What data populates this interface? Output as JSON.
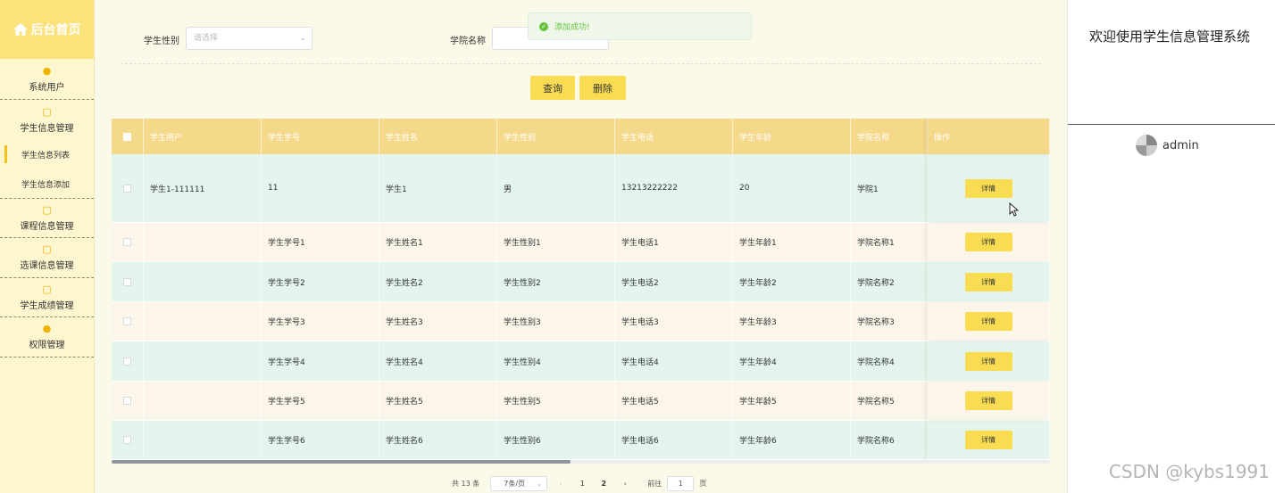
{
  "sidebar": {
    "home_label": "后台首页",
    "items": [
      {
        "label": "系统用户",
        "icon": "user-icon"
      },
      {
        "label": "学生信息管理",
        "icon": "note-icon",
        "children": [
          "学生信息列表",
          "学生信息添加"
        ]
      },
      {
        "label": "课程信息管理",
        "icon": "note-icon"
      },
      {
        "label": "选课信息管理",
        "icon": "note-icon"
      },
      {
        "label": "学生成绩管理",
        "icon": "note-icon"
      },
      {
        "label": "权限管理",
        "icon": "user-icon"
      }
    ],
    "active_child": "学生信息列表"
  },
  "header": {
    "welcome": "欢迎使用学生信息管理系统",
    "username": "admin"
  },
  "filters": {
    "gender_label": "学生性别",
    "gender_placeholder": "请选择",
    "college_label": "学院名称",
    "college_value": ""
  },
  "toast": {
    "message": "添加成功!"
  },
  "toolbar": {
    "query_label": "查询",
    "delete_label": "删除"
  },
  "table": {
    "columns": [
      "学生用户",
      "学生学号",
      "学生姓名",
      "学生性别",
      "学生电话",
      "学生年龄",
      "学院名称",
      "操作"
    ],
    "rows": [
      [
        "学生1-111111",
        "11",
        "学生1",
        "男",
        "13213222222",
        "20",
        "学院1"
      ],
      [
        "",
        "学生学号1",
        "学生姓名1",
        "学生性别1",
        "学生电话1",
        "学生年龄1",
        "学院名称1"
      ],
      [
        "",
        "学生学号2",
        "学生姓名2",
        "学生性别2",
        "学生电话2",
        "学生年龄2",
        "学院名称2"
      ],
      [
        "",
        "学生学号3",
        "学生姓名3",
        "学生性别3",
        "学生电话3",
        "学生年龄3",
        "学院名称3"
      ],
      [
        "",
        "学生学号4",
        "学生姓名4",
        "学生性别4",
        "学生电话4",
        "学生年龄4",
        "学院名称4"
      ],
      [
        "",
        "学生学号5",
        "学生姓名5",
        "学生性别5",
        "学生电话5",
        "学生年龄5",
        "学院名称5"
      ],
      [
        "",
        "学生学号6",
        "学生姓名6",
        "学生性别6",
        "学生电话6",
        "学生年龄6",
        "学院名称6"
      ]
    ],
    "action_label": "详情"
  },
  "pagination": {
    "total": "共 13 条",
    "page_size": "7条/页",
    "pages": [
      "1",
      "2"
    ],
    "current_page": "2",
    "goto_prefix": "前往",
    "goto_value": "1",
    "goto_suffix": "页"
  },
  "watermark": "CSDN @kybs1991",
  "colors": {
    "accent": "#f9dc51",
    "header_bg": "#f5d98a",
    "row_mint": "#e3f5ec",
    "row_cream": "#fbf5ea",
    "success": "#67c23a"
  }
}
